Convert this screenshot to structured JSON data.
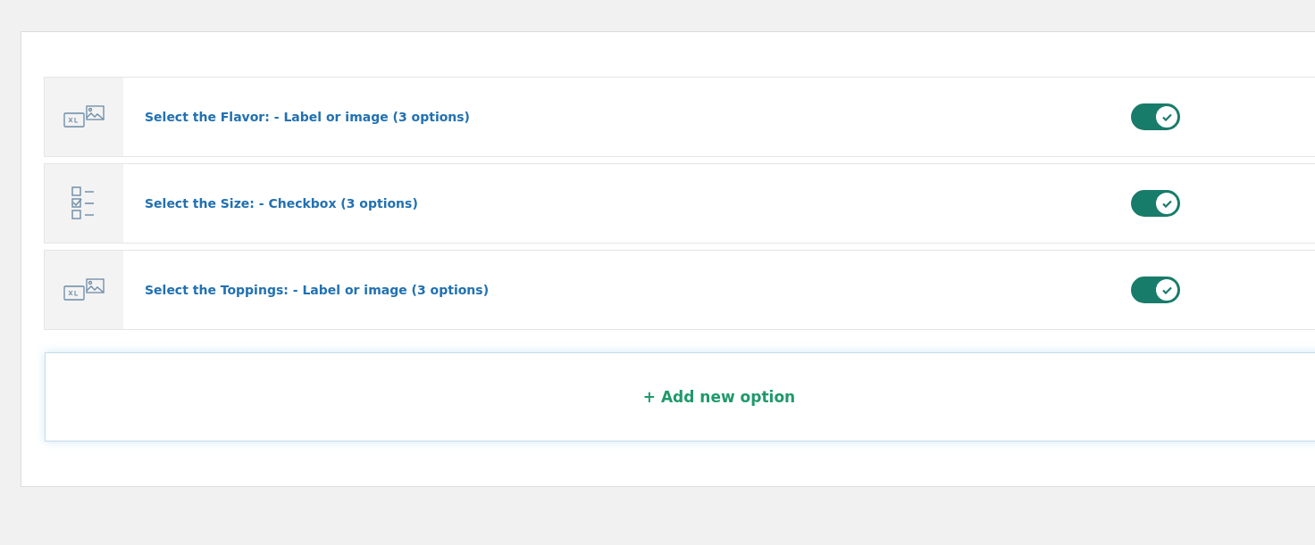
{
  "options": [
    {
      "kind": "image",
      "title": "Select the Flavor: - Label or image (3 options)",
      "on": true
    },
    {
      "kind": "checkbox",
      "title": "Select the Size: - Checkbox (3 options)",
      "on": true
    },
    {
      "kind": "image",
      "title": "Select the Toppings: - Label or image (3 options)",
      "on": true
    }
  ],
  "add_button": "+ Add new option"
}
